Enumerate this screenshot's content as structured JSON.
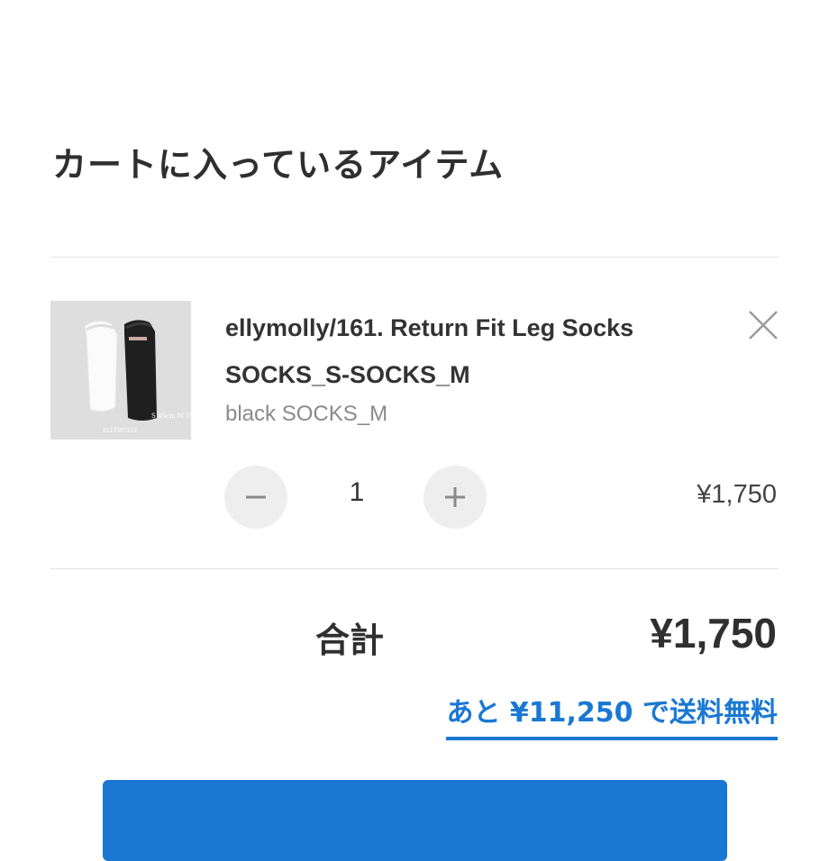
{
  "cart": {
    "title": "カートに入っているアイテム"
  },
  "item": {
    "name": "ellymolly/161. Return Fit Leg Socks SOCKS_S-SOCKS_M",
    "variant": "black SOCKS_M",
    "quantity": "1",
    "price": "¥1,750",
    "image_label_brand": "ELLYMOLLY",
    "image_label_size": "S 45cm M 50cm"
  },
  "summary": {
    "total_label": "合計",
    "total_value": "¥1,750",
    "shipping_notice": "あと ¥11,250 で送料無料"
  },
  "icons": {
    "remove": "close-icon",
    "decrease": "minus-icon",
    "increase": "plus-icon"
  },
  "colors": {
    "accent": "#1a78d2",
    "divider": "#e3e3e3",
    "button_bg": "#eeeeee"
  }
}
